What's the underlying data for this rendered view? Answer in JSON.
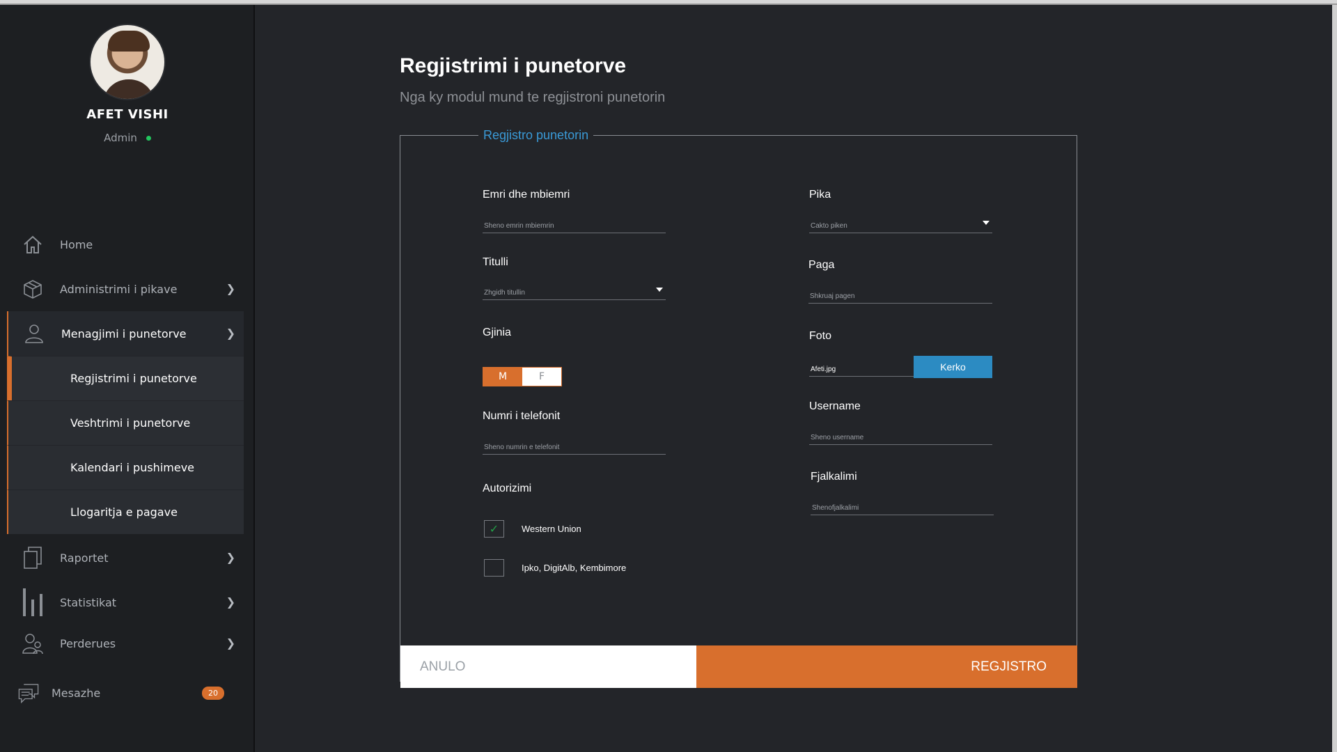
{
  "profile": {
    "name": "AFET VISHI",
    "role": "Admin"
  },
  "sidebar": {
    "items": [
      {
        "label": "Home",
        "icon": "home-icon"
      },
      {
        "label": "Administrimi i pikave",
        "icon": "box-icon"
      },
      {
        "label": "Menagjimi i punetorve",
        "icon": "user-icon"
      },
      {
        "label": "Raportet",
        "icon": "reports-icon"
      },
      {
        "label": "Statistikat",
        "icon": "stats-icon"
      },
      {
        "label": "Perderues",
        "icon": "users-icon"
      },
      {
        "label": "Mesazhe",
        "icon": "messages-icon"
      }
    ],
    "subitems": [
      {
        "label": "Regjistrimi i punetorve"
      },
      {
        "label": "Veshtrimi i punetorve"
      },
      {
        "label": "Kalendari i pushimeve"
      },
      {
        "label": "Llogaritja e pagave"
      }
    ],
    "messages_count": "20"
  },
  "page": {
    "title": "Regjistrimi i punetorve",
    "subtitle": "Nga ky modul mund te regjistroni punetorin"
  },
  "form": {
    "legend": "Regjistro punetorin",
    "name_label": "Emri dhe mbiemri",
    "name_placeholder": "Sheno emrin mbiemrin",
    "title_label": "Titulli",
    "title_placeholder": "Zhgidh titullin",
    "gender_label": "Gjinia",
    "gender_m": "M",
    "gender_f": "F",
    "gender_selected": "M",
    "phone_label": "Numri i telefonit",
    "phone_placeholder": "Sheno numrin e telefonit",
    "auth_label": "Autorizimi",
    "auth_options": [
      {
        "label": "Western Union",
        "checked": true
      },
      {
        "label": "Ipko, DigitAlb, Kembimore",
        "checked": false
      }
    ],
    "pika_label": "Pika",
    "pika_placeholder": "Cakto piken",
    "paga_label": "Paga",
    "paga_placeholder": "Shkruaj pagen",
    "foto_label": "Foto",
    "foto_value": "Afeti.jpg",
    "foto_button": "Kerko",
    "username_label": "Username",
    "username_placeholder": "Sheno username",
    "password_label": "Fjalkalimi",
    "password_placeholder": "Shenofjalkalimi",
    "cancel_label": "ANULO",
    "submit_label": "REGJISTRO"
  },
  "colors": {
    "accent": "#d86f2d",
    "link": "#3a9ad7",
    "button_blue": "#2c8bc2",
    "background": "#232529",
    "sidebar": "#1d1f22",
    "online": "#22c55e"
  }
}
